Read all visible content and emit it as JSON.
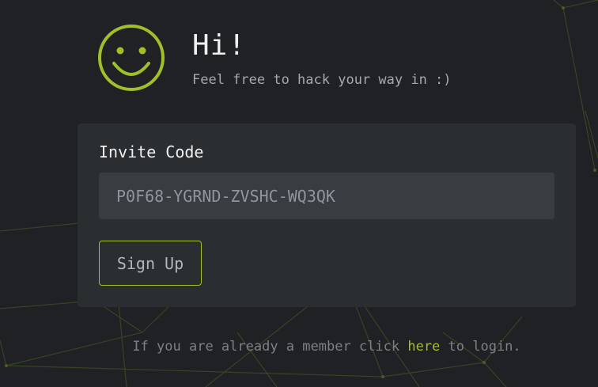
{
  "header": {
    "title": "Hi!",
    "subtitle": "Feel free to hack your way in :)"
  },
  "form": {
    "label": "Invite Code",
    "invite_code_value": "P0F68-YGRND-ZVSHC-WQ3QK",
    "submit_label": "Sign Up"
  },
  "footer": {
    "text_before": "If you are already a member click ",
    "link_label": "here",
    "text_after": " to login."
  },
  "colors": {
    "accent": "#9fc028",
    "background": "#1f2124",
    "card": "#2b2e31",
    "input": "#383d42"
  },
  "icons": {
    "logo": "smiley-face-icon"
  }
}
